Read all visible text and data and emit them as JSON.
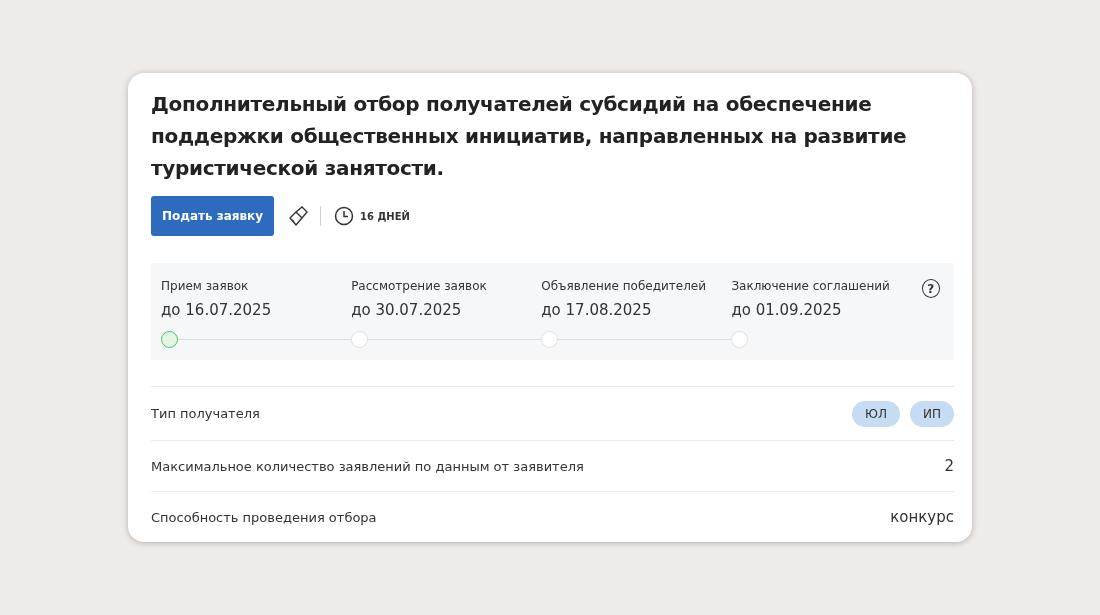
{
  "title": "Дополнительный отбор получателей субсидий на обеспечение поддержки общественных инициатив, направленных на развитие туристической занятости.",
  "apply_button": "Подать заявку",
  "days_left": "16 ДНЕЙ",
  "stages": [
    {
      "label": "Прием заявок",
      "date": "до 16.07.2025",
      "active": true
    },
    {
      "label": "Рассмотрение заявок",
      "date": "до 30.07.2025",
      "active": false
    },
    {
      "label": "Объявление победителей",
      "date": "до 17.08.2025",
      "active": false
    },
    {
      "label": "Заключение соглашений",
      "date": "до 01.09.2025",
      "active": false
    }
  ],
  "help_icon": "?",
  "rows": [
    {
      "kind": "tags",
      "label": "Тип получателя",
      "tags": [
        "ЮЛ",
        "ИП"
      ]
    },
    {
      "kind": "text",
      "label": "Максимальное количество заявлений по данным от заявителя",
      "value": "2"
    },
    {
      "kind": "text",
      "label": "Способность проведения отбора",
      "value": "конкурс"
    }
  ]
}
